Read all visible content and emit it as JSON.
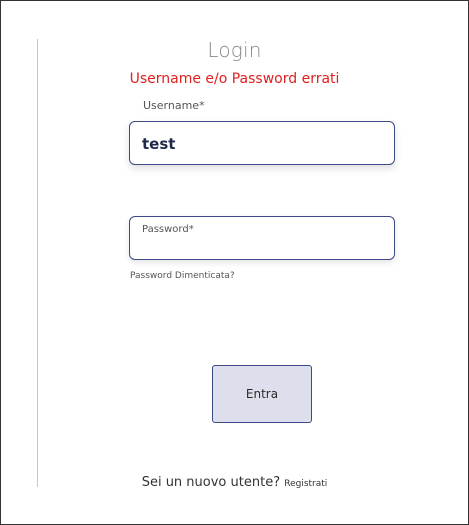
{
  "login": {
    "title": "Login",
    "error": "Username e/o Password errati",
    "username": {
      "label": "Username*",
      "value": "test"
    },
    "password": {
      "placeholder": "Password*"
    },
    "forgot_link": "Password Dimenticata?",
    "submit_label": "Entra",
    "new_user_text": "Sei un nuovo utente?",
    "register_link": "Registrati"
  }
}
